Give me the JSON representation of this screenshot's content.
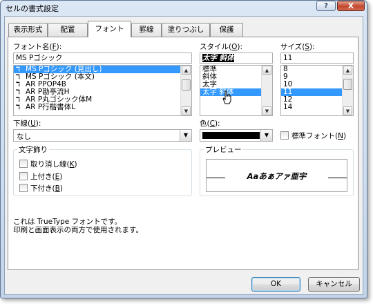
{
  "window": {
    "title": "セルの書式設定",
    "help_label": "?",
    "close_label": "X"
  },
  "tabs": [
    {
      "label": "表示形式",
      "active": false
    },
    {
      "label": "配置",
      "active": false
    },
    {
      "label": "フォント",
      "active": true
    },
    {
      "label": "罫線",
      "active": false
    },
    {
      "label": "塗りつぶし",
      "active": false
    },
    {
      "label": "保護",
      "active": false
    }
  ],
  "font": {
    "label": "フォント名",
    "key": "F",
    "value": "MS Pゴシック",
    "items": [
      "MS Pゴシック (見出し)",
      "MS Pゴシック (本文)",
      "AR PPOP4B",
      "AR P勘亭流H",
      "AR P丸ゴシック体M",
      "AR P行楷書体L"
    ],
    "selected_index": 0,
    "icon": "truetype-icon"
  },
  "style": {
    "label": "スタイル",
    "key": "O",
    "value": "太字 斜体",
    "items": [
      "標準",
      "斜体",
      "太字",
      "太字 斜体"
    ],
    "selected_index": 3
  },
  "size": {
    "label": "サイズ",
    "key": "S",
    "value": "11",
    "items": [
      "8",
      "9",
      "10",
      "11",
      "12",
      "14"
    ],
    "selected_index": 3
  },
  "underline": {
    "label": "下線",
    "key": "U",
    "value": "なし"
  },
  "color": {
    "label": "色",
    "key": "C",
    "value_color": "#000000"
  },
  "normal_font": {
    "label": "標準フォント",
    "key": "N",
    "checked": false
  },
  "effects": {
    "title": "文字飾り",
    "items": [
      {
        "label": "取り消し線",
        "key": "K",
        "checked": false
      },
      {
        "label": "上付き",
        "key": "E",
        "checked": false
      },
      {
        "label": "下付き",
        "key": "B",
        "checked": false
      }
    ]
  },
  "preview": {
    "title": "プレビュー",
    "sample": "Aaあぁアァ亜宇"
  },
  "info": {
    "line1": "これは TrueType フォントです。",
    "line2": "印刷と画面表示の両方で使用されます。"
  },
  "buttons": {
    "ok": "OK",
    "cancel": "キャンセル"
  }
}
